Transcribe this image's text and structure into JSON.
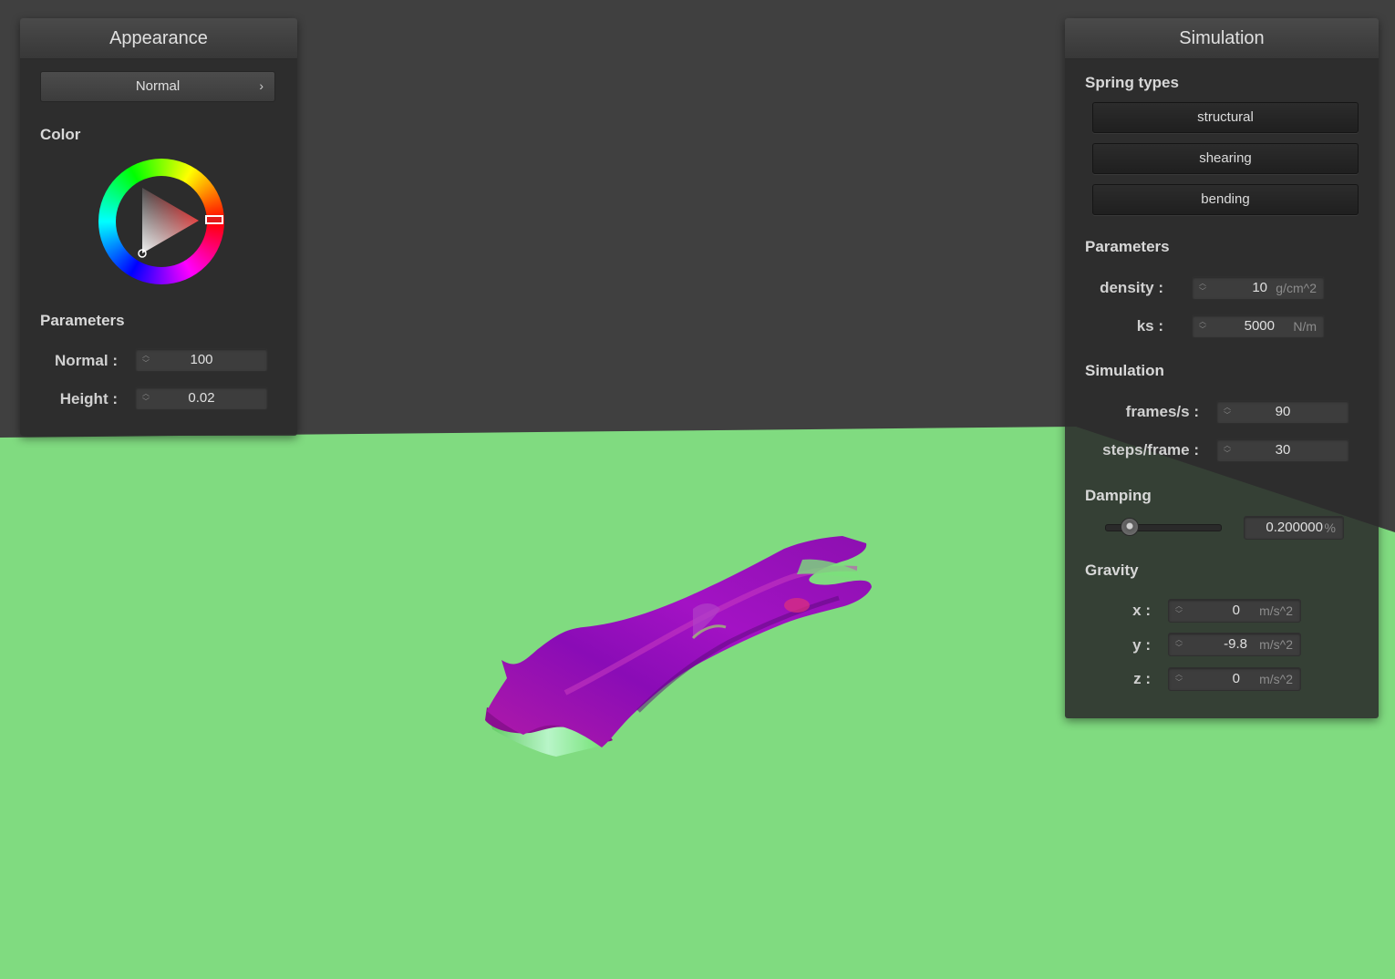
{
  "appearance": {
    "title": "Appearance",
    "shader_select": "Normal",
    "color_label": "Color",
    "parameters_label": "Parameters",
    "normal_label": "Normal :",
    "normal_value": "100",
    "height_label": "Height :",
    "height_value": "0.02",
    "picked_color": "#e01a1a"
  },
  "simulation": {
    "title": "Simulation",
    "spring_types_label": "Spring types",
    "springs": [
      "structural",
      "shearing",
      "bending"
    ],
    "parameters_label": "Parameters",
    "density_label": "density :",
    "density_value": "10",
    "density_unit": "g/cm^2",
    "ks_label": "ks :",
    "ks_value": "5000",
    "ks_unit": "N/m",
    "simulation_label": "Simulation",
    "fps_label": "frames/s :",
    "fps_value": "90",
    "steps_label": "steps/frame :",
    "steps_value": "30",
    "damping_label": "Damping",
    "damping_value": "0.200000",
    "damping_unit": "%",
    "damping_fraction": 0.2,
    "gravity_label": "Gravity",
    "x_label": "x :",
    "x_value": "0",
    "y_label": "y :",
    "y_value": "-9.8",
    "z_label": "z :",
    "z_value": "0",
    "gravity_unit": "m/s^2"
  },
  "scene": {
    "background_color": "#404040",
    "ground_color": "#80db80",
    "cloth_color": "#9a10b8"
  }
}
